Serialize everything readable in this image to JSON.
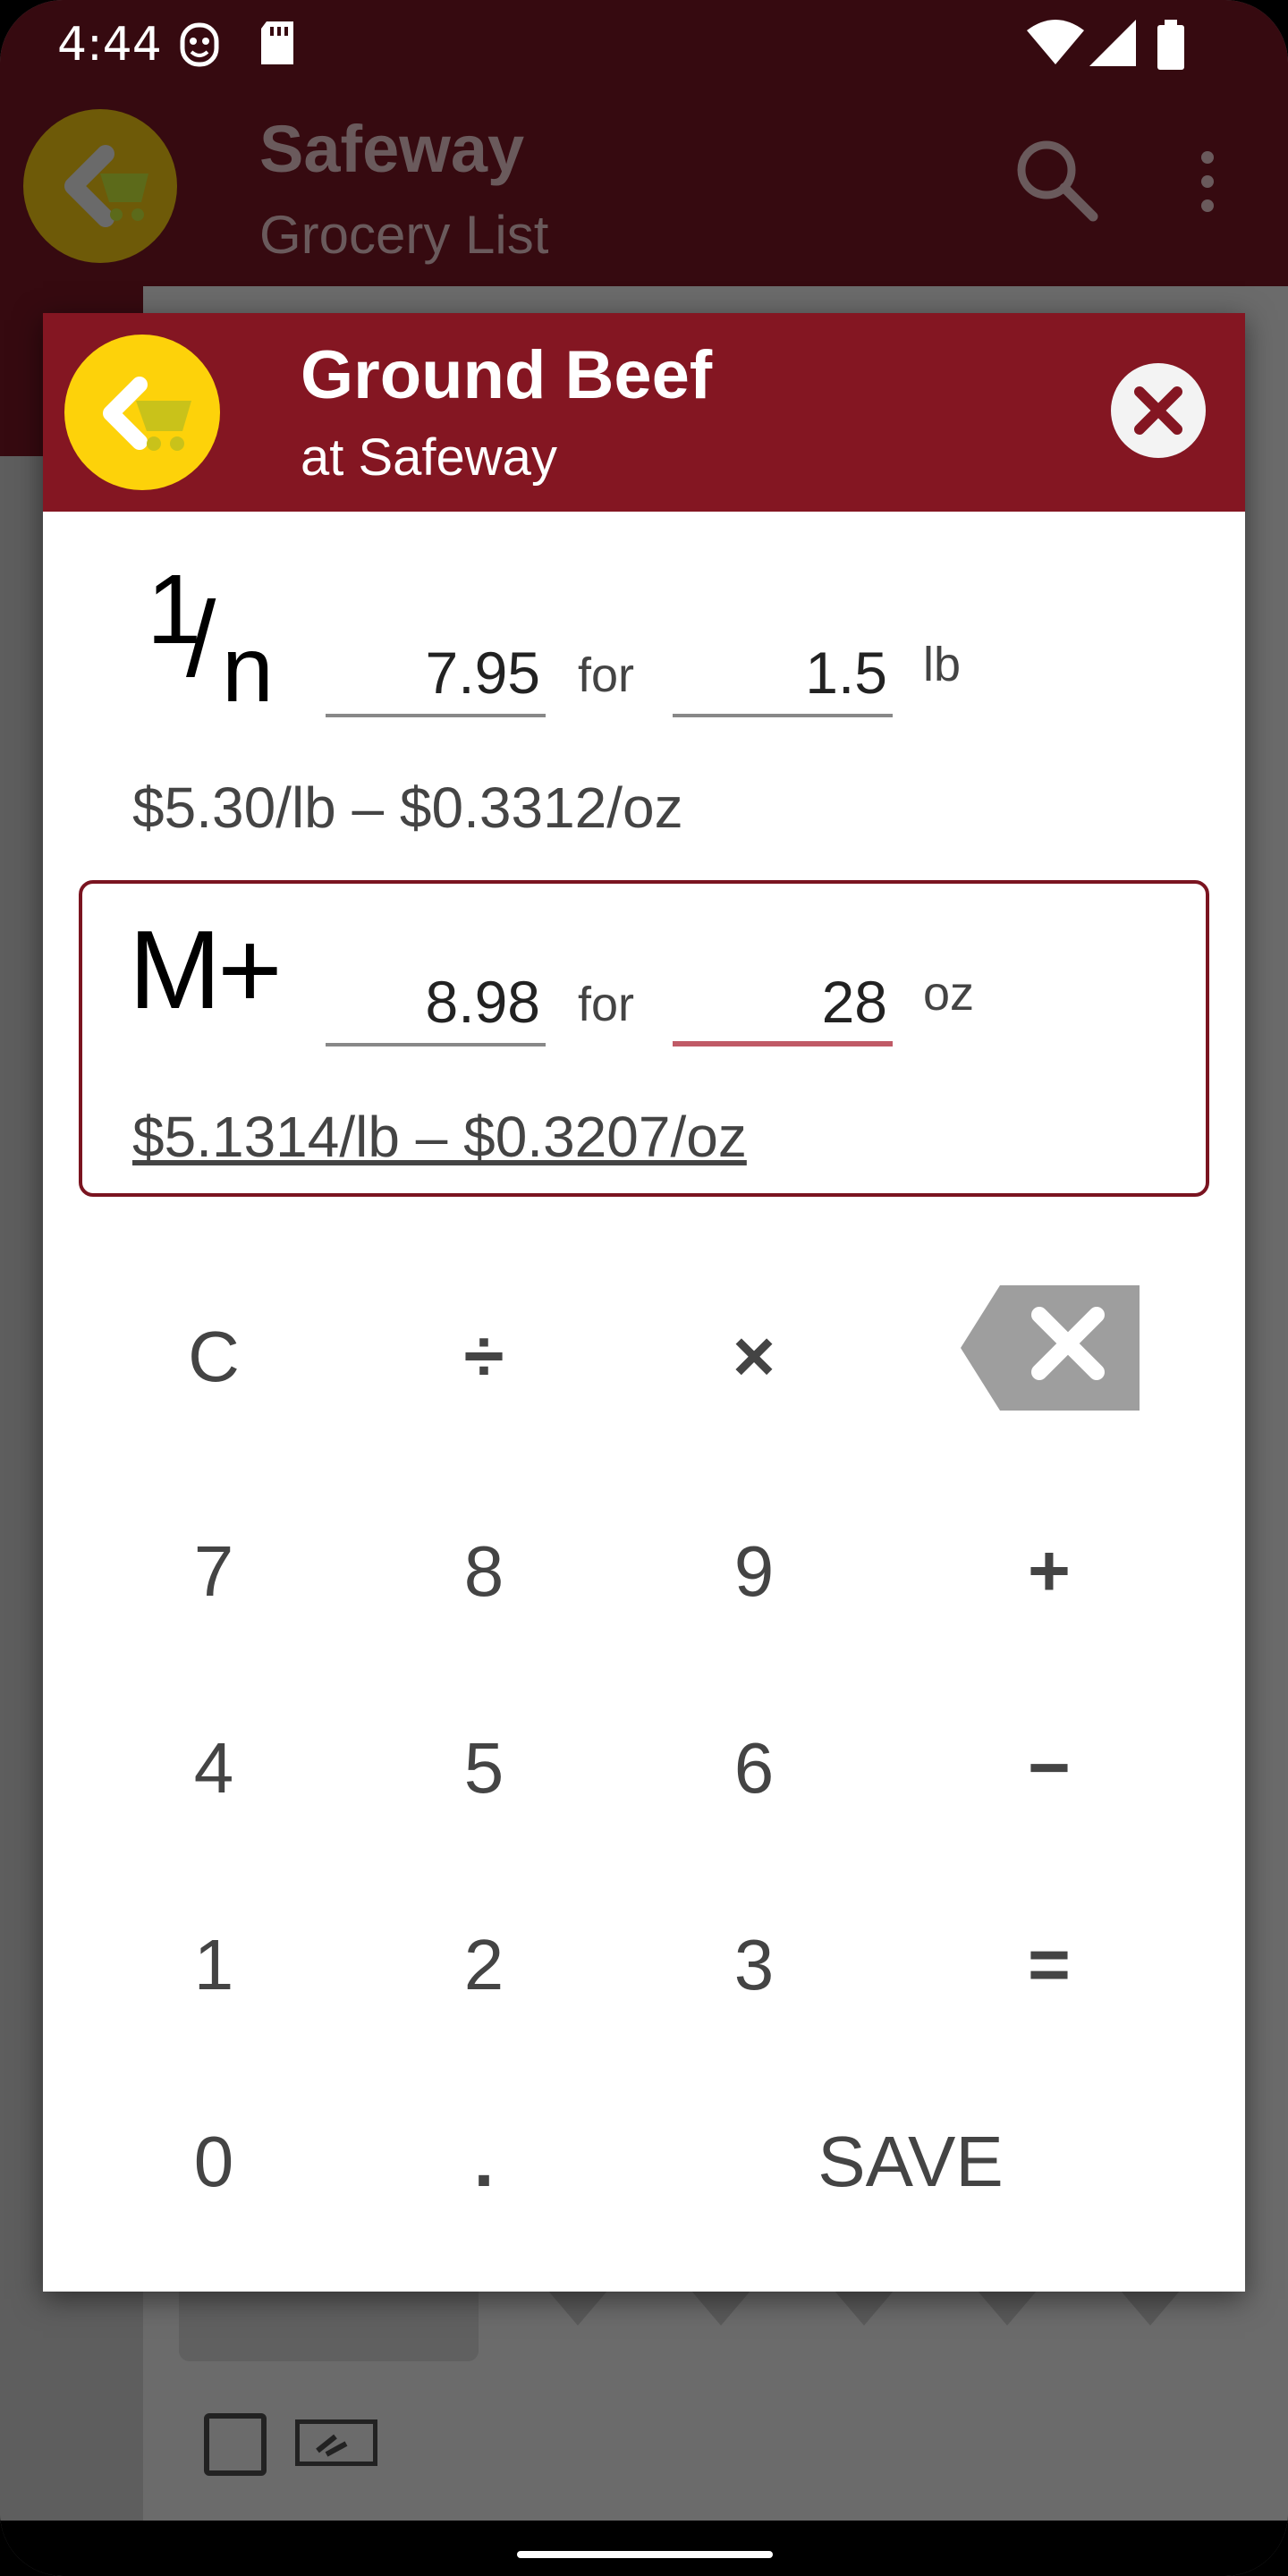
{
  "status_bar": {
    "time": "4:44"
  },
  "app_bar": {
    "title": "Safeway",
    "subtitle": "Grocery List"
  },
  "dialog": {
    "title": "Ground Beef",
    "subtitle": "at Safeway",
    "reciprocal_row": {
      "mode_one": "1",
      "mode_slash": "/",
      "mode_n": "n",
      "price": "7.95",
      "for_label": "for",
      "quantity": "1.5",
      "unit": "lb",
      "result": "$5.30/lb – $0.3312/oz"
    },
    "memory_row": {
      "mode_label": "M+",
      "price": "8.98",
      "for_label": "for",
      "quantity": "28",
      "unit": "oz",
      "result": "$5.1314/lb – $0.3207/oz"
    },
    "keypad": {
      "clear": "C",
      "divide": "÷",
      "multiply": "×",
      "k7": "7",
      "k8": "8",
      "k9": "9",
      "plus": "+",
      "k4": "4",
      "k5": "5",
      "k6": "6",
      "minus": "−",
      "k1": "1",
      "k2": "2",
      "k3": "3",
      "equals": "=",
      "k0": "0",
      "dot": ".",
      "save": "SAVE"
    }
  },
  "colors": {
    "header": "#841622",
    "fab": "#fdd20a",
    "status_bar": "#360a10",
    "active_underline": "#c05a66"
  },
  "icons": [
    "cart-back-icon",
    "search-icon",
    "more-vert-icon",
    "close-icon",
    "backspace-icon",
    "wifi-icon",
    "signal-icon",
    "battery-icon",
    "sd-card-icon",
    "face-icon"
  ]
}
